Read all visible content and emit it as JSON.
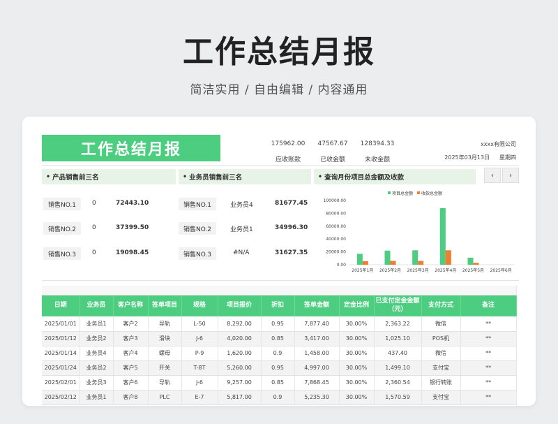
{
  "page": {
    "title": "工作总结月报",
    "subtitle": "简洁实用 / 自由编辑 / 内容通用"
  },
  "sheet": {
    "header_title": "工作总结月报",
    "kpis": [
      {
        "value": "175962.00",
        "label": "应收账款"
      },
      {
        "value": "47567.67",
        "label": "已收金额"
      },
      {
        "value": "128394.33",
        "label": "未收金额"
      }
    ],
    "company": "xxxx有限公司",
    "date": "2025年03月13日",
    "weekday": "星期四",
    "sections": {
      "product": "产品销售前三名",
      "salesperson": "业务员销售前三名",
      "query": "查询月份项目总金额及收款"
    },
    "nav": {
      "prev": "‹",
      "next": "›"
    },
    "product_top": [
      {
        "rank": "销售NO.1",
        "value": "0",
        "amount": "72443.10"
      },
      {
        "rank": "销售NO.2",
        "value": "0",
        "amount": "37399.50"
      },
      {
        "rank": "销售NO.3",
        "value": "0",
        "amount": "19098.45"
      }
    ],
    "salesperson_top": [
      {
        "rank": "销售NO.1",
        "name": "业务员4",
        "amount": "81677.45"
      },
      {
        "rank": "销售NO.2",
        "name": "业务员1",
        "amount": "34996.30"
      },
      {
        "rank": "销售NO.3",
        "name": "#N/A",
        "amount": "31627.35"
      }
    ]
  },
  "colors": {
    "accent": "#4ccd7f",
    "series_total": "#4ccd7f",
    "series_received": "#f07c30"
  },
  "chart_data": {
    "type": "bar",
    "categories": [
      "2025年1月",
      "2025年2月",
      "2025年3月",
      "2025年4月",
      "2025年5月",
      "2025年6月"
    ],
    "series": [
      {
        "name": "项目总金额",
        "values": [
          17000,
          22000,
          22500,
          88000,
          11000,
          0
        ]
      },
      {
        "name": "收款总金额",
        "values": [
          5500,
          6000,
          6000,
          22500,
          3000,
          0
        ]
      }
    ],
    "yticks": [
      "0.00",
      "20000.00",
      "40000.00",
      "60000.00",
      "80000.00",
      "100000.00"
    ],
    "ylim": [
      0,
      100000
    ],
    "legend": "top",
    "grid": false
  },
  "table": {
    "headers": [
      "日期",
      "业务员",
      "客户名称",
      "签单项目",
      "规格",
      "项目报价",
      "折扣",
      "签单金额",
      "定金比例",
      "已支付定金金额（元）",
      "支付方式",
      "备注"
    ],
    "rows": [
      [
        "2025/01/01",
        "业务员1",
        "客户2",
        "导轨",
        "L-50",
        "8,292.00",
        "0.95",
        "7,877.40",
        "30.00%",
        "2,363.22",
        "微信",
        "**"
      ],
      [
        "2025/01/12",
        "业务员2",
        "客户3",
        "滑块",
        "J-6",
        "4,020.00",
        "0.85",
        "3,417.00",
        "30.00%",
        "1,025.10",
        "POS机",
        "**"
      ],
      [
        "2025/01/14",
        "业务员4",
        "客户4",
        "螺母",
        "P-9",
        "1,620.00",
        "0.9",
        "1,458.00",
        "30.00%",
        "437.40",
        "微信",
        "**"
      ],
      [
        "2025/01/24",
        "业务员2",
        "客户5",
        "开关",
        "T-8T",
        "5,260.00",
        "0.95",
        "4,997.00",
        "30.00%",
        "1,499.10",
        "支付宝",
        "**"
      ],
      [
        "2025/02/01",
        "业务员3",
        "客户6",
        "导轨",
        "J-6",
        "9,257.00",
        "0.85",
        "7,868.45",
        "30.00%",
        "2,360.54",
        "银行转账",
        "**"
      ],
      [
        "2025/02/12",
        "业务员1",
        "客户8",
        "PLC",
        "E-7",
        "5,817.00",
        "0.9",
        "5,235.30",
        "30.00%",
        "1,570.59",
        "支付宝",
        "**"
      ]
    ]
  }
}
